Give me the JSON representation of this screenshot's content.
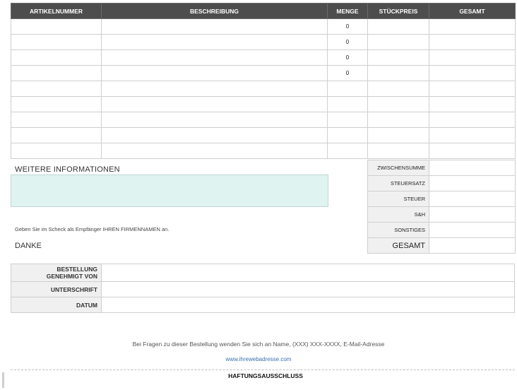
{
  "table": {
    "headers": [
      "ARTIKELNUMMER",
      "BESCHREIBUNG",
      "MENGE",
      "STÜCKPREIS",
      "GESAMT"
    ],
    "rows": [
      [
        "",
        "",
        "0",
        "",
        ""
      ],
      [
        "",
        "",
        "0",
        "",
        ""
      ],
      [
        "",
        "",
        "0",
        "",
        ""
      ],
      [
        "",
        "",
        "0",
        "",
        ""
      ],
      [
        "",
        "",
        "",
        "",
        ""
      ],
      [
        "",
        "",
        "",
        "",
        ""
      ],
      [
        "",
        "",
        "",
        "",
        ""
      ],
      [
        "",
        "",
        "",
        "",
        ""
      ],
      [
        "",
        "",
        "",
        "",
        ""
      ]
    ]
  },
  "summary": {
    "subtotal_label": "ZWISCHENSUMME",
    "taxrate_label": "STEUERSATZ",
    "tax_label": "STEUER",
    "shipping_label": "S&H",
    "other_label": "SONSTIGES",
    "total_label": "GESAMT"
  },
  "info": {
    "title": "WEITERE INFORMATIONEN",
    "check_note": "Geben Sie im Scheck als Empfänger IHREN FIRMENNAMEN an.",
    "thanks": "DANKE"
  },
  "approval": {
    "approved_by_line1": "BESTELLUNG",
    "approved_by_line2": "GENEHMIGT VON",
    "signature": "UNTERSCHRIFT",
    "date": "DATUM"
  },
  "footer": {
    "contact": "Bei Fragen zu dieser Bestellung wenden Sie sich an Name, (XXX) XXX-XXXX, E-Mail-Adresse",
    "website": "www.ihrewebadresse.com",
    "disclaimer": "HAFTUNGSAUSSCHLUSS"
  }
}
